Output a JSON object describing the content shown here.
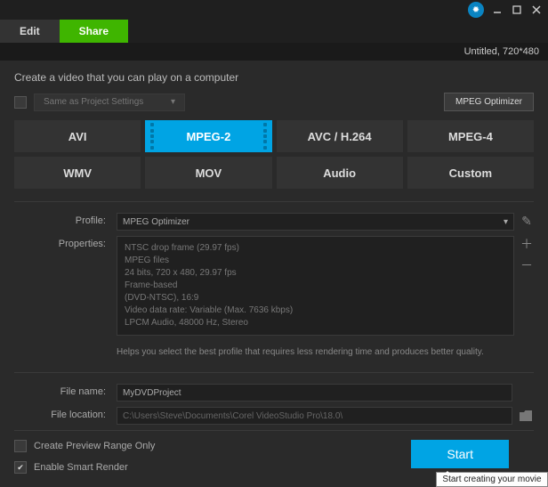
{
  "window": {
    "doc_title": "Untitled, 720*480"
  },
  "tabs": {
    "edit": "Edit",
    "share": "Share"
  },
  "heading": "Create a video that you can play on a computer",
  "same_settings_label": "Same as Project Settings",
  "mpeg_optimizer_btn": "MPEG Optimizer",
  "formats": {
    "avi": "AVI",
    "mpeg2": "MPEG-2",
    "avc": "AVC / H.264",
    "mpeg4": "MPEG-4",
    "wmv": "WMV",
    "mov": "MOV",
    "audio": "Audio",
    "custom": "Custom"
  },
  "profile": {
    "label": "Profile:",
    "value": "MPEG Optimizer"
  },
  "properties": {
    "label": "Properties:",
    "lines": [
      "NTSC drop frame (29.97 fps)",
      "MPEG files",
      "24 bits, 720 x 480, 29.97 fps",
      "Frame-based",
      "(DVD-NTSC),   16:9",
      "Video data rate: Variable (Max.  7636 kbps)",
      "LPCM Audio, 48000 Hz, Stereo"
    ],
    "helper": "Helps you select the best profile that requires less rendering time and produces better quality."
  },
  "filename": {
    "label": "File name:",
    "value": "MyDVDProject"
  },
  "filelocation": {
    "label": "File location:",
    "value": "C:\\Users\\Steve\\Documents\\Corel VideoStudio Pro\\18.0\\"
  },
  "checks": {
    "preview_range": "Create Preview Range Only",
    "smart_render": "Enable Smart Render"
  },
  "start": {
    "label": "Start",
    "tooltip": "Start creating your movie"
  }
}
